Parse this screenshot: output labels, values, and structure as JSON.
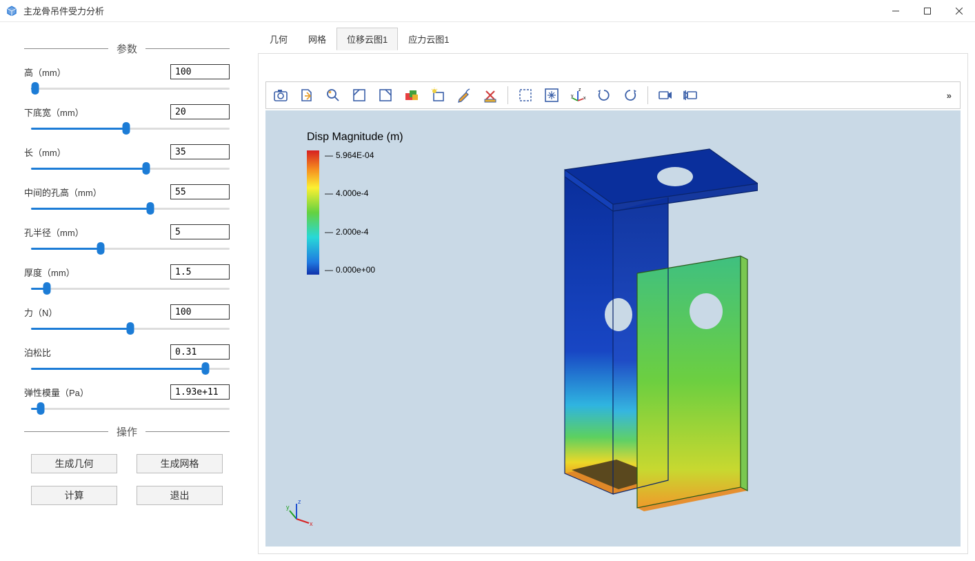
{
  "window": {
    "title": "主龙骨吊件受力分析"
  },
  "sidebar": {
    "section_params": "参数",
    "section_actions": "操作",
    "params": [
      {
        "label": "高（mm）",
        "value": "100",
        "pos": 2
      },
      {
        "label": "下底宽（mm）",
        "value": "20",
        "pos": 48
      },
      {
        "label": "长（mm）",
        "value": "35",
        "pos": 58
      },
      {
        "label": "中间的孔高（mm）",
        "value": "55",
        "pos": 60
      },
      {
        "label": "孔半径（mm）",
        "value": "5",
        "pos": 35
      },
      {
        "label": "厚度（mm）",
        "value": "1.5",
        "pos": 8
      },
      {
        "label": "力（N）",
        "value": "100",
        "pos": 50
      },
      {
        "label": "泊松比",
        "value": "0.31",
        "pos": 88
      },
      {
        "label": "弹性模量（Pa）",
        "value": "1.93e+11",
        "pos": 5
      }
    ],
    "buttons": {
      "gen_geom": "生成几何",
      "gen_mesh": "生成网格",
      "compute": "计算",
      "exit": "退出"
    }
  },
  "tabs": {
    "items": [
      "几何",
      "网格",
      "位移云图1",
      "应力云图1"
    ],
    "active_index": 2
  },
  "toolbar_icons": [
    "camera-icon",
    "export-icon",
    "zoom-icon",
    "box-nw-icon",
    "box-ne-icon",
    "multibox-icon",
    "bulb-box-icon",
    "brush-icon",
    "delete-ruler-icon",
    "sep",
    "select-area-icon",
    "fit-icon",
    "axis-icon",
    "rotate-cw-icon",
    "rotate-ccw-icon",
    "sep",
    "camera-rec-icon",
    "camera-prev-icon"
  ],
  "legend": {
    "title": "Disp Magnitude (m)",
    "ticks": [
      "5.964E-04",
      "4.000e-4",
      "2.000e-4",
      "0.000e+00"
    ]
  }
}
